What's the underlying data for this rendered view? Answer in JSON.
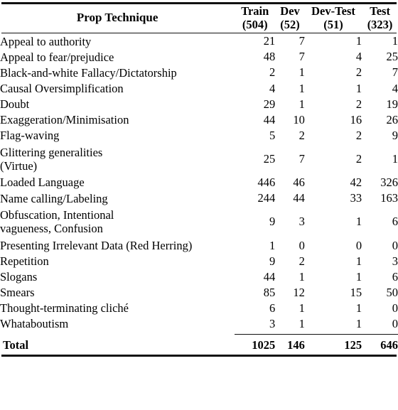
{
  "table": {
    "row_header_title": "Prop Technique",
    "columns": [
      {
        "name": "Train",
        "count": "(504)"
      },
      {
        "name": "Dev",
        "count": "(52)"
      },
      {
        "name": "Dev-Test",
        "count": "(51)"
      },
      {
        "name": "Test",
        "count": "(323)"
      }
    ],
    "rows": [
      {
        "label": "Appeal to authority",
        "label_line2": "",
        "train": "21",
        "dev": "7",
        "devtest": "1",
        "test": "1"
      },
      {
        "label": "Appeal to fear/prejudice",
        "label_line2": "",
        "train": "48",
        "dev": "7",
        "devtest": "4",
        "test": "25"
      },
      {
        "label": "Black-and-white Fallacy/Dictatorship",
        "label_line2": "",
        "train": "2",
        "dev": "1",
        "devtest": "2",
        "test": "7"
      },
      {
        "label": "Causal Oversimplification",
        "label_line2": "",
        "train": "4",
        "dev": "1",
        "devtest": "1",
        "test": "4"
      },
      {
        "label": "Doubt",
        "label_line2": "",
        "train": "29",
        "dev": "1",
        "devtest": "2",
        "test": "19"
      },
      {
        "label": "Exaggeration/Minimisation",
        "label_line2": "",
        "train": "44",
        "dev": "10",
        "devtest": "16",
        "test": "26"
      },
      {
        "label": "Flag-waving",
        "label_line2": "",
        "train": "5",
        "dev": "2",
        "devtest": "2",
        "test": "9"
      },
      {
        "label": "Glittering generalities",
        "label_line2": "(Virtue)",
        "train": "25",
        "dev": "7",
        "devtest": "2",
        "test": "1"
      },
      {
        "label": "Loaded Language",
        "label_line2": "",
        "train": "446",
        "dev": "46",
        "devtest": "42",
        "test": "326"
      },
      {
        "label": "Name calling/Labeling",
        "label_line2": "",
        "train": "244",
        "dev": "44",
        "devtest": "33",
        "test": "163"
      },
      {
        "label": "Obfuscation, Intentional",
        "label_line2": "vagueness, Confusion",
        "train": "9",
        "dev": "3",
        "devtest": "1",
        "test": "6"
      },
      {
        "label": "Presenting Irrelevant Data (Red Herring)",
        "label_line2": "",
        "train": "1",
        "dev": "0",
        "devtest": "0",
        "test": "0"
      },
      {
        "label": "Repetition",
        "label_line2": "",
        "train": "9",
        "dev": "2",
        "devtest": "1",
        "test": "3"
      },
      {
        "label": "Slogans",
        "label_line2": "",
        "train": "44",
        "dev": "1",
        "devtest": "1",
        "test": "6"
      },
      {
        "label": "Smears",
        "label_line2": "",
        "train": "85",
        "dev": "12",
        "devtest": "15",
        "test": "50"
      },
      {
        "label": "Thought-terminating cliché",
        "label_line2": "",
        "train": "6",
        "dev": "1",
        "devtest": "1",
        "test": "0"
      },
      {
        "label": "Whataboutism",
        "label_line2": "",
        "train": "3",
        "dev": "1",
        "devtest": "1",
        "test": "0"
      }
    ],
    "total": {
      "label": "Total",
      "train": "1025",
      "dev": "146",
      "devtest": "125",
      "test": "646"
    }
  }
}
